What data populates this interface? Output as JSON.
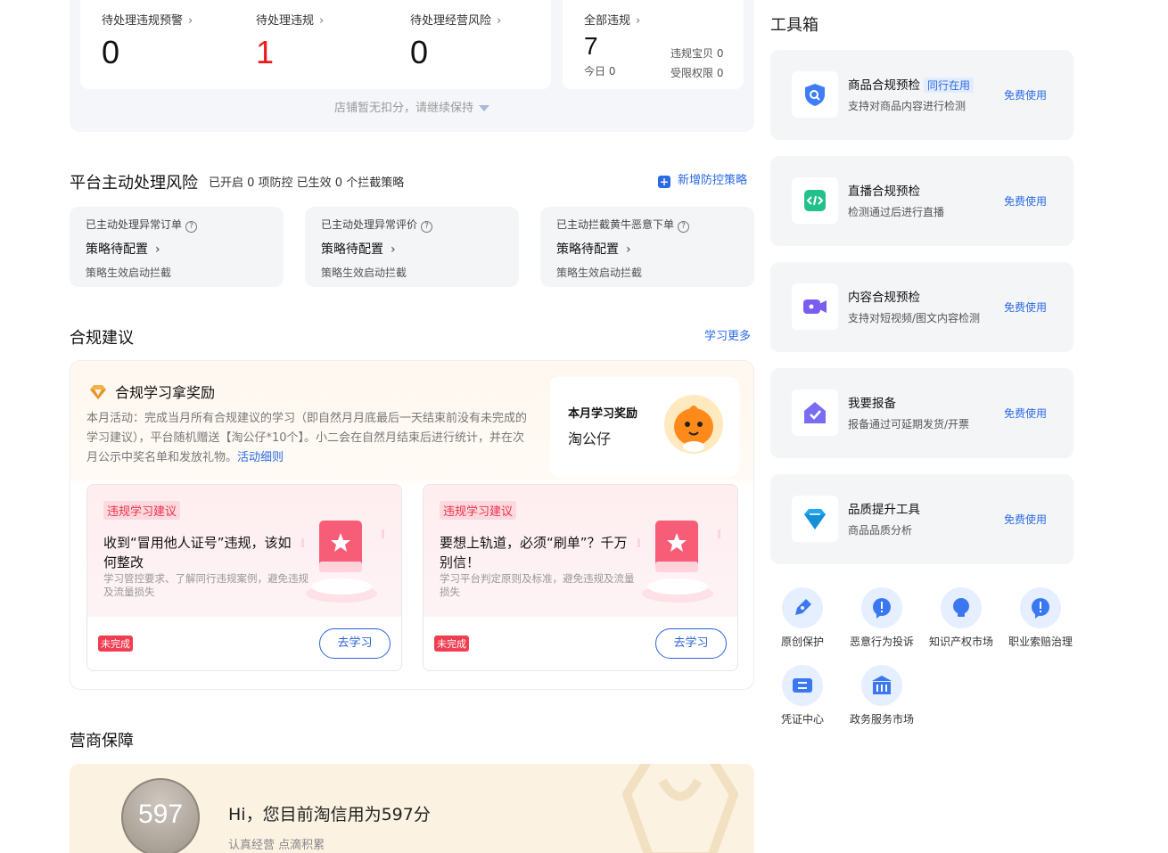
{
  "violations": {
    "items": [
      {
        "title": "待处理违规预警",
        "value": "0"
      },
      {
        "title": "待处理违规",
        "value": "1"
      },
      {
        "title": "待处理经营风险",
        "value": "0"
      }
    ],
    "all": {
      "title": "全部违规",
      "value": "7",
      "today_label": "今日",
      "today_value": "0",
      "goods_label": "违规宝贝",
      "goods_value": "0",
      "limit_label": "受限权限",
      "limit_value": "0"
    },
    "chevron": "›",
    "no_deduct": "店铺暂无扣分，请继续保持"
  },
  "risk": {
    "title": "平台主动处理风险",
    "summary": "已开启 0 项防控 已生效 0 个拦截策略",
    "add_link": "新增防控策略",
    "cards": [
      {
        "title": "已主动处理异常订单",
        "status": "策略待配置",
        "desc": "策略生效启动拦截"
      },
      {
        "title": "已主动处理异常评价",
        "status": "策略待配置",
        "desc": "策略生效启动拦截"
      },
      {
        "title": "已主动拦截黄牛恶意下单",
        "status": "策略待配置",
        "desc": "策略生效启动拦截"
      }
    ]
  },
  "compliance": {
    "title": "合规建议",
    "more_link": "学习更多",
    "reward_title": "合规学习拿奖励",
    "reward_desc": "本月活动：完成当月所有合规建议的学习（即自然月月底最后一天结束前没有未完成的学习建议），平台随机赠送【淘公仔*10个】。小二会在自然月结束后进行统计，并在次月公示中奖名单和发放礼物。",
    "reward_link": "活动细则",
    "month_title": "本月学习奖励",
    "month_prize": "淘公仔",
    "courses": [
      {
        "tag": "违规学习建议",
        "head": "收到“冒用他人证号”违规，该如何整改",
        "sub": "学习管控要求、了解同行违规案例，避免违规及流量损失",
        "status": "未完成",
        "button": "去学习"
      },
      {
        "tag": "违规学习建议",
        "head": "要想上轨道，必须“刷单”？千万别信！",
        "sub": "学习平台判定原则及标准，避免违规及流量损失",
        "status": "未完成",
        "button": "去学习"
      }
    ]
  },
  "guarantee": {
    "title": "营商保障",
    "score": "597",
    "text": "Hi，您目前淘信用为597分",
    "sub": "认真经营 点滴积累"
  },
  "toolbox": {
    "title": "工具箱",
    "tools": [
      {
        "name": "商品合规预检",
        "badge": "同行在用",
        "desc": "支持对商品内容进行检测",
        "action": "免费使用",
        "icon": "shield-search-icon"
      },
      {
        "name": "直播合规预检",
        "badge": "",
        "desc": "检测通过后进行直播",
        "action": "免费使用",
        "icon": "code-icon"
      },
      {
        "name": "内容合规预检",
        "badge": "",
        "desc": "支持对短视频/图文内容检测",
        "action": "免费使用",
        "icon": "video-icon"
      },
      {
        "name": "我要报备",
        "badge": "",
        "desc": "报备通过可延期发货/开票",
        "action": "免费使用",
        "icon": "house-check-icon"
      },
      {
        "name": "品质提升工具",
        "badge": "",
        "desc": "商品品质分析",
        "action": "免费使用",
        "icon": "diamond-icon"
      }
    ],
    "quick": [
      {
        "label": "原创保护",
        "icon": "pen-icon"
      },
      {
        "label": "恶意行为投诉",
        "icon": "alert-icon"
      },
      {
        "label": "知识产权市场",
        "icon": "bulb-icon"
      },
      {
        "label": "职业索赔治理",
        "icon": "alert-icon"
      },
      {
        "label": "凭证中心",
        "icon": "voucher-icon"
      },
      {
        "label": "政务服务市场",
        "icon": "building-icon"
      }
    ]
  },
  "colors": {
    "accent": "#2a6ae6",
    "danger": "#ee1a1a",
    "tag_red": "#f03d52"
  }
}
